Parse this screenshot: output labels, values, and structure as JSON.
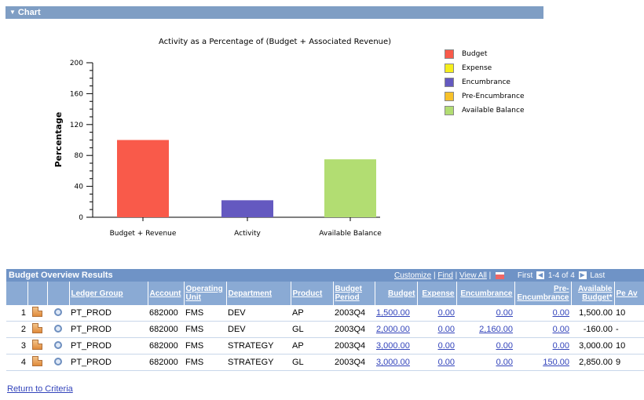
{
  "chart_section": {
    "toggle_icon": "triangle-down-icon",
    "title": "Chart"
  },
  "chart_data": {
    "type": "bar",
    "title": "Activity as a Percentage of (Budget + Associated Revenue)",
    "xlabel": "",
    "ylabel": "Percentage",
    "ylim": [
      0,
      200
    ],
    "yticks": [
      "0",
      "40",
      "80",
      "120",
      "160",
      "200"
    ],
    "categories": [
      "Budget + Revenue",
      "Activity",
      "Available Balance"
    ],
    "values": [
      100,
      22,
      75
    ],
    "bar_colors": [
      "#f95a4a",
      "#6459c0",
      "#b2dd72"
    ],
    "grid": false,
    "legend_position": "right",
    "legend": [
      {
        "label": "Budget",
        "color": "#f95a4a"
      },
      {
        "label": "Expense",
        "color": "#f5ee1c"
      },
      {
        "label": "Encumbrance",
        "color": "#6459c0"
      },
      {
        "label": "Pre-Encumbrance",
        "color": "#f7c12a"
      },
      {
        "label": "Available Balance",
        "color": "#b2dd72"
      }
    ]
  },
  "results": {
    "title": "Budget Overview Results",
    "nav": {
      "customize": "Customize",
      "find": "Find",
      "view_all": "View All",
      "first": "First",
      "range": "1-4 of 4",
      "last": "Last",
      "sep": "|"
    },
    "columns": [
      "",
      "",
      "",
      "Ledger Group",
      "Account",
      "Operating Unit",
      "Department",
      "Product",
      "Budget Period",
      "Budget",
      "Expense",
      "Encumbrance",
      "Pre-Encumbrance",
      "Available Budget*",
      "Pe Av"
    ],
    "rows": [
      {
        "n": "1",
        "ledger_group": "PT_PROD",
        "account": "682000",
        "unit": "FMS",
        "department": "DEV",
        "product": "AP",
        "period": "2003Q4",
        "budget": "1,500.00",
        "expense": "0.00",
        "encumbrance": "0.00",
        "pre_encumbrance": "0.00",
        "available": "1,500.00",
        "pct": "10"
      },
      {
        "n": "2",
        "ledger_group": "PT_PROD",
        "account": "682000",
        "unit": "FMS",
        "department": "DEV",
        "product": "GL",
        "period": "2003Q4",
        "budget": "2,000.00",
        "expense": "0.00",
        "encumbrance": "2,160.00",
        "pre_encumbrance": "0.00",
        "available": "-160.00",
        "pct": "-"
      },
      {
        "n": "3",
        "ledger_group": "PT_PROD",
        "account": "682000",
        "unit": "FMS",
        "department": "STRATEGY",
        "product": "AP",
        "period": "2003Q4",
        "budget": "3,000.00",
        "expense": "0.00",
        "encumbrance": "0.00",
        "pre_encumbrance": "0.00",
        "available": "3,000.00",
        "pct": "10"
      },
      {
        "n": "4",
        "ledger_group": "PT_PROD",
        "account": "682000",
        "unit": "FMS",
        "department": "STRATEGY",
        "product": "GL",
        "period": "2003Q4",
        "budget": "3,000.00",
        "expense": "0.00",
        "encumbrance": "0.00",
        "pre_encumbrance": "150.00",
        "available": "2,850.00",
        "pct": "9"
      }
    ]
  },
  "footer": {
    "return_link": "Return to Criteria"
  }
}
